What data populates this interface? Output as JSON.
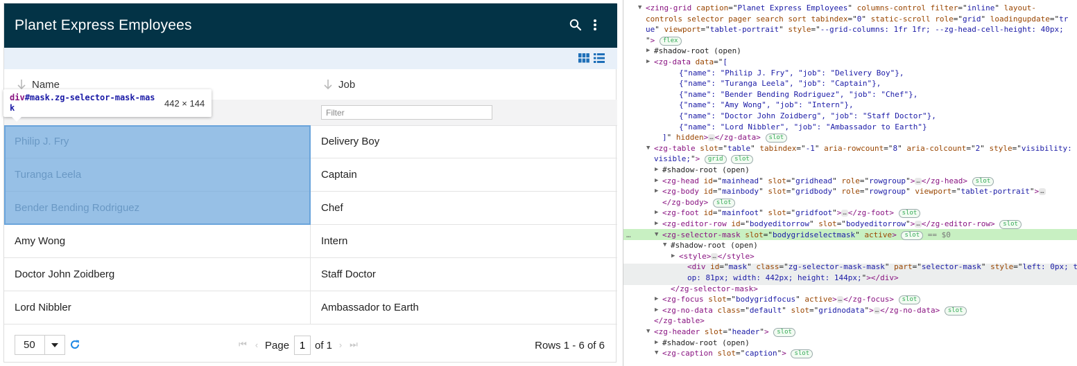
{
  "grid": {
    "caption": "Planet Express Employees",
    "columns": [
      "Name",
      "Job"
    ],
    "filter_placeholder": "Filter",
    "rows": [
      [
        "Philip J. Fry",
        "Delivery Boy"
      ],
      [
        "Turanga Leela",
        "Captain"
      ],
      [
        "Bender Bending Rodriguez",
        "Chef"
      ],
      [
        "Amy Wong",
        "Intern"
      ],
      [
        "Doctor John Zoidberg",
        "Staff Doctor"
      ],
      [
        "Lord Nibbler",
        "Ambassador to Earth"
      ]
    ],
    "selected_rows": [
      0,
      1,
      2
    ],
    "pager": {
      "page_size": "50",
      "page_label": "Page",
      "page_value": "1",
      "of_label": "of 1",
      "rows_info": "Rows 1 - 6 of 6"
    },
    "colors": {
      "caption_bg": "#033346",
      "controlbar_bg": "#e8f0f9",
      "mask": "#6fa8dc",
      "refresh": "#1e88e5"
    }
  },
  "tooltip": {
    "tag": "div",
    "selector": "#mask.zg-selector-mask-mask",
    "size": "442 × 144"
  },
  "devtools": {
    "lines": [
      {
        "tri": "▼",
        "indent": 2,
        "html": "<span class=\"tg\">&lt;zing-grid</span> <span class=\"at\">caption</span>=\"<span class=\"av\">Planet Express Employees</span>\" <span class=\"at\">columns-control</span> <span class=\"at\">filter</span>=\"<span class=\"av\">inline</span>\" <span class=\"at\">layout-</span>"
      },
      {
        "indent": 2,
        "html": "<span class=\"at\">controls</span> <span class=\"at\">selector</span> <span class=\"at\">pager</span> <span class=\"at\">search</span> <span class=\"at\">sort</span> <span class=\"at\">tabindex</span>=\"<span class=\"av\">0</span>\" <span class=\"at\">static-scroll</span> <span class=\"at\">role</span>=\"<span class=\"av\">grid</span>\" <span class=\"at\">loadingupdate</span>=\"<span class=\"av\">tr</span>"
      },
      {
        "indent": 2,
        "html": "<span class=\"av\">ue</span>\" <span class=\"at\">viewport</span>=\"<span class=\"av\">tablet-portrait</span>\" <span class=\"at\">style</span>=\"<span class=\"av\">--grid-columns: 1fr 1fr; --zg-head-cell-height: 40px;</span>"
      },
      {
        "indent": 2,
        "html": "\"<span class=\"tg\">&gt;</span> <span class=\"badge\">flex</span>"
      },
      {
        "tri": "▶",
        "indent": 3,
        "html": "<span class=\"sr\">#shadow-root (open)</span>"
      },
      {
        "tri": "▶",
        "indent": 3,
        "html": "<span class=\"tg\">&lt;zg-data</span> <span class=\"at\">data</span>=\"<span class=\"av\">[</span>"
      },
      {
        "indent": 6,
        "html": "<span class=\"av\">{\"name\": \"Philip J. Fry\", \"job\": \"Delivery Boy\"},</span>"
      },
      {
        "indent": 6,
        "html": "<span class=\"av\">{\"name\": \"Turanga Leela\", \"job\": \"Captain\"},</span>"
      },
      {
        "indent": 6,
        "html": "<span class=\"av\">{\"name\": \"Bender Bending Rodriguez\", \"job\": \"Chef\"},</span>"
      },
      {
        "indent": 6,
        "html": "<span class=\"av\">{\"name\": \"Amy Wong\", \"job\": \"Intern\"},</span>"
      },
      {
        "indent": 6,
        "html": "<span class=\"av\">{\"name\": \"Doctor John Zoidberg\", \"job\": \"Staff Doctor\"},</span>"
      },
      {
        "indent": 6,
        "html": "<span class=\"av\">{\"name\": \"Lord Nibbler\", \"job\": \"Ambassador to Earth\"}</span>"
      },
      {
        "indent": 4,
        "html": "<span class=\"av\">]</span>\" <span class=\"at\">hidden</span><span class=\"tg\">&gt;</span><span class=\"ell\">…</span><span class=\"tg\">&lt;/zg-data&gt;</span> <span class=\"badge\">slot</span>"
      },
      {
        "tri": "▼",
        "indent": 3,
        "html": "<span class=\"tg\">&lt;zg-table</span> <span class=\"at\">slot</span>=\"<span class=\"av\">table</span>\" <span class=\"at\">tabindex</span>=\"<span class=\"av\">-1</span>\" <span class=\"at\">aria-rowcount</span>=\"<span class=\"av\">8</span>\" <span class=\"at\">aria-colcount</span>=\"<span class=\"av\">2</span>\" <span class=\"at\">style</span>=\"<span class=\"av\">visibility:</span>"
      },
      {
        "indent": 3,
        "html": "<span class=\"av\">visible;</span>\"<span class=\"tg\">&gt;</span> <span class=\"badge\">grid</span> <span class=\"badge\">slot</span>"
      },
      {
        "tri": "▶",
        "indent": 4,
        "html": "<span class=\"sr\">#shadow-root (open)</span>"
      },
      {
        "tri": "▶",
        "indent": 4,
        "html": "<span class=\"tg\">&lt;zg-head</span> <span class=\"at\">id</span>=\"<span class=\"av\">mainhead</span>\" <span class=\"at\">slot</span>=\"<span class=\"av\">gridhead</span>\" <span class=\"at\">role</span>=\"<span class=\"av\">rowgroup</span>\"<span class=\"tg\">&gt;</span><span class=\"ell\">…</span><span class=\"tg\">&lt;/zg-head&gt;</span> <span class=\"badge\">slot</span>"
      },
      {
        "tri": "▶",
        "indent": 4,
        "html": "<span class=\"tg\">&lt;zg-body</span> <span class=\"at\">id</span>=\"<span class=\"av\">mainbody</span>\" <span class=\"at\">slot</span>=\"<span class=\"av\">gridbody</span>\" <span class=\"at\">role</span>=\"<span class=\"av\">rowgroup</span>\" <span class=\"at\">viewport</span>=\"<span class=\"av\">tablet-portrait</span>\"<span class=\"tg\">&gt;</span><span class=\"ell\">…</span>"
      },
      {
        "indent": 4,
        "html": "<span class=\"tg\">&lt;/zg-body&gt;</span> <span class=\"badge\">slot</span>"
      },
      {
        "tri": "▶",
        "indent": 4,
        "html": "<span class=\"tg\">&lt;zg-foot</span> <span class=\"at\">id</span>=\"<span class=\"av\">mainfoot</span>\" <span class=\"at\">slot</span>=\"<span class=\"av\">gridfoot</span>\"<span class=\"tg\">&gt;</span><span class=\"ell\">…</span><span class=\"tg\">&lt;/zg-foot&gt;</span> <span class=\"badge\">slot</span>"
      },
      {
        "tri": "▶",
        "indent": 4,
        "html": "<span class=\"tg\">&lt;zg-editor-row</span> <span class=\"at\">id</span>=\"<span class=\"av\">bodyeditorrow</span>\" <span class=\"at\">slot</span>=\"<span class=\"av\">bodyeditorrow</span>\"<span class=\"tg\">&gt;</span><span class=\"ell\">…</span><span class=\"tg\">&lt;/zg-editor-row&gt;</span> <span class=\"badge\">slot</span>"
      },
      {
        "tri": "▼",
        "indent": 4,
        "html": "<span class=\"tg\">&lt;zg-selector-mask</span> <span class=\"at\">slot</span>=\"<span class=\"av\">bodygridselectmask</span>\" <span class=\"at\">active</span><span class=\"tg\">&gt;</span> <span class=\"badge\">slot</span> <span class=\"muted\">== $0</span>",
        "prefix": "…"
      },
      {
        "tri": "▼",
        "indent": 5,
        "html": "<span class=\"sr\">#shadow-root (open)</span>"
      },
      {
        "tri": "▶",
        "indent": 6,
        "html": "<span class=\"tg\">&lt;style&gt;</span><span class=\"ell\">…</span><span class=\"tg\">&lt;/style&gt;</span>"
      },
      {
        "indent": 7,
        "html": "<span class=\"tg\">&lt;div</span> <span class=\"at\">id</span>=\"<span class=\"av\">mask</span>\" <span class=\"at\">class</span>=\"<span class=\"av\">zg-selector-mask-mask</span>\" <span class=\"at\">part</span>=\"<span class=\"av\">selector-mask</span>\" <span class=\"at\">style</span>=\"<span class=\"av\">left: 0px; t</span>"
      },
      {
        "indent": 7,
        "html": "<span class=\"av\">op: 81px; width: 442px; height: 144px;</span>\"<span class=\"tg\">&gt;&lt;/div&gt;</span>"
      },
      {
        "indent": 5,
        "html": "<span class=\"tg\">&lt;/zg-selector-mask&gt;</span>"
      },
      {
        "tri": "▶",
        "indent": 4,
        "html": "<span class=\"tg\">&lt;zg-focus</span> <span class=\"at\">slot</span>=\"<span class=\"av\">bodygridfocus</span>\" <span class=\"at\">active</span><span class=\"tg\">&gt;</span><span class=\"ell\">…</span><span class=\"tg\">&lt;/zg-focus&gt;</span> <span class=\"badge\">slot</span>"
      },
      {
        "tri": "▶",
        "indent": 4,
        "html": "<span class=\"tg\">&lt;zg-no-data</span> <span class=\"at\">class</span>=\"<span class=\"av\">default</span>\" <span class=\"at\">slot</span>=\"<span class=\"av\">gridnodata</span>\"<span class=\"tg\">&gt;</span><span class=\"ell\">…</span><span class=\"tg\">&lt;/zg-no-data&gt;</span> <span class=\"badge\">slot</span>"
      },
      {
        "indent": 3,
        "html": "<span class=\"tg\">&lt;/zg-table&gt;</span>"
      },
      {
        "tri": "▼",
        "indent": 3,
        "html": "<span class=\"tg\">&lt;zg-header</span> <span class=\"at\">slot</span>=\"<span class=\"av\">header</span>\"<span class=\"tg\">&gt;</span> <span class=\"badge\">slot</span>"
      },
      {
        "tri": "▶",
        "indent": 4,
        "html": "<span class=\"sr\">#shadow-root (open)</span>"
      },
      {
        "tri": "▼",
        "indent": 4,
        "html": "<span class=\"tg\">&lt;zg-caption</span> <span class=\"at\">slot</span>=\"<span class=\"av\">caption</span>\"<span class=\"tg\">&gt;</span> <span class=\"badge\">slot</span>"
      }
    ]
  }
}
